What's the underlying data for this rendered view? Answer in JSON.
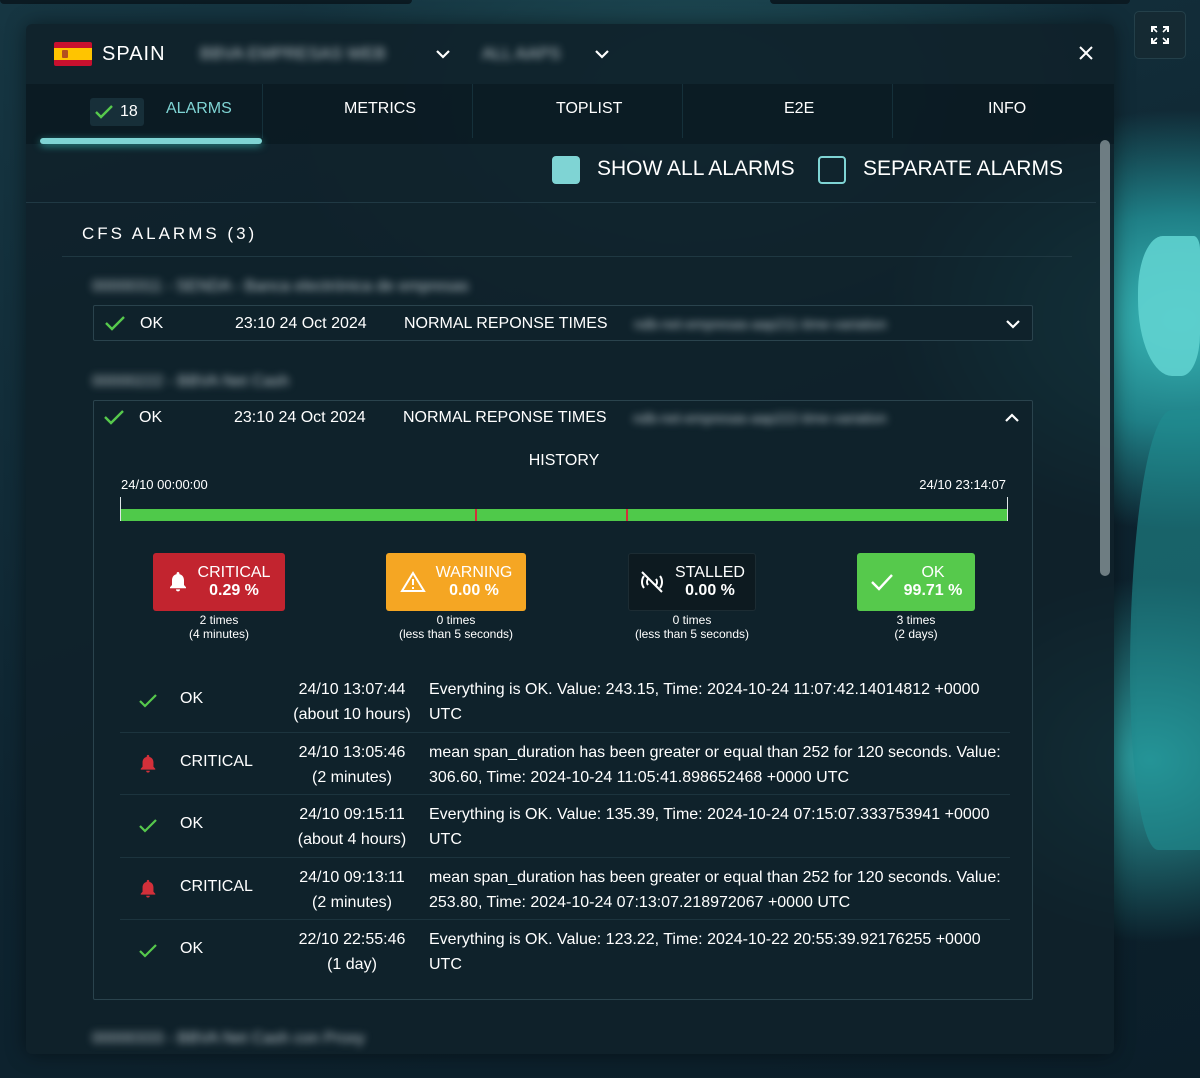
{
  "header": {
    "country": "SPAIN",
    "selector_1": "BBVA EMPRESAS WEB",
    "selector_2": "ALL AAPS"
  },
  "tabs": {
    "alarms_count": "18",
    "alarms": "ALARMS",
    "metrics": "METRICS",
    "toplist": "TOPLIST",
    "e2e": "E2E",
    "info": "INFO"
  },
  "options": {
    "show_all_alarms": "SHOW ALL ALARMS",
    "show_all_checked": true,
    "separate_alarms": "SEPARATE ALARMS",
    "separate_checked": false
  },
  "section": {
    "title": "CFS ALARMS (3)"
  },
  "groups": [
    {
      "name": "00000311 - SENDA - Banca electrónica de empresas",
      "row": {
        "status": "OK",
        "date": "23:10 24 Oct 2024",
        "name": "NORMAL REPONSE TIMES",
        "metric": "ndb-net-empresas-aap211-time-variation"
      }
    },
    {
      "name": "00000222 - BBVA Net Cash",
      "row": {
        "status": "OK",
        "date": "23:10 24 Oct 2024",
        "name": "NORMAL REPONSE TIMES",
        "metric": "ndb-net-empresas-aap222-time-variation"
      }
    },
    {
      "name": "00000333 - BBVA Net Cash con Proxy"
    }
  ],
  "history": {
    "title": "HISTORY",
    "start": "24/10 00:00:00",
    "end": "24/10 23:14:07",
    "critical_marks": [
      0.4,
      0.57
    ],
    "stats": [
      {
        "label": "CRITICAL",
        "value": "0.29 %",
        "times": "2 times",
        "duration": "(4 minutes)",
        "color": "#c2242f",
        "icon": "bell-icon"
      },
      {
        "label": "WARNING",
        "value": "0.00 %",
        "times": "0 times",
        "duration": "(less than 5 seconds)",
        "color": "#f5a623",
        "icon": "warning-icon"
      },
      {
        "label": "STALLED",
        "value": "0.00 %",
        "times": "0 times",
        "duration": "(less than 5 seconds)",
        "color": "#0d1a20",
        "icon": "no-signal-icon"
      },
      {
        "label": "OK",
        "value": "99.71 %",
        "times": "3 times",
        "duration": "(2 days)",
        "color": "#56c94c",
        "icon": "check-icon"
      }
    ],
    "entries": [
      {
        "status": "OK",
        "date": "24/10 13:07:44",
        "ago": "(about 10 hours)",
        "message": "Everything is OK. Value: 243.15, Time: 2024-10-24 11:07:42.14014812 +0000 UTC"
      },
      {
        "status": "CRITICAL",
        "date": "24/10 13:05:46",
        "ago": "(2 minutes)",
        "message": "mean span_duration has been greater or equal than 252 for 120 seconds. Value: 306.60, Time: 2024-10-24 11:05:41.898652468 +0000 UTC"
      },
      {
        "status": "OK",
        "date": "24/10 09:15:11",
        "ago": "(about 4 hours)",
        "message": "Everything is OK. Value: 135.39, Time: 2024-10-24 07:15:07.333753941 +0000 UTC"
      },
      {
        "status": "CRITICAL",
        "date": "24/10 09:13:11",
        "ago": "(2 minutes)",
        "message": "mean span_duration has been greater or equal than 252 for 120 seconds. Value: 253.80, Time: 2024-10-24 07:13:07.218972067 +0000 UTC"
      },
      {
        "status": "OK",
        "date": "22/10 22:55:46",
        "ago": "(1 day)",
        "message": "Everything is OK. Value: 123.22, Time: 2024-10-22 20:55:39.92176255 +0000 UTC"
      }
    ]
  },
  "colors": {
    "accent": "#7fd4d4",
    "ok": "#56c94c",
    "critical": "#d3303a"
  }
}
